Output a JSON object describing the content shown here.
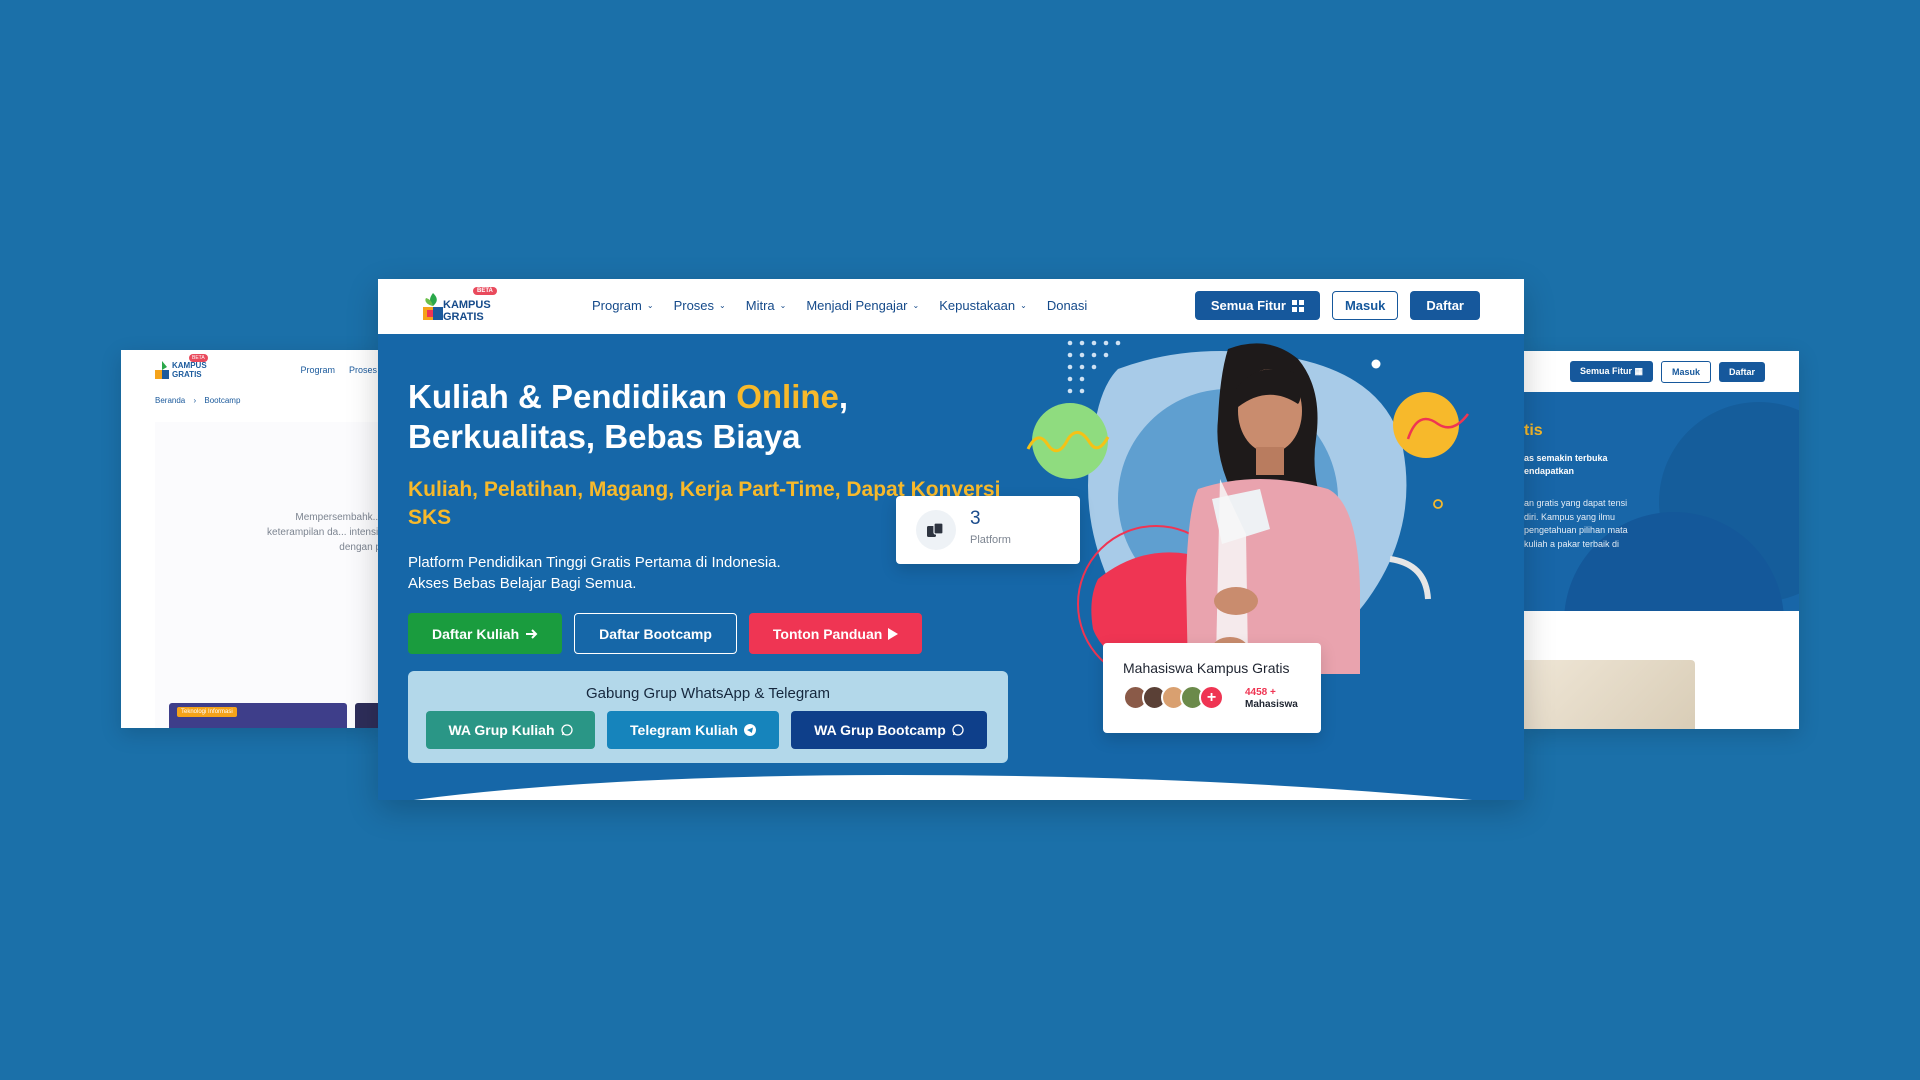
{
  "left_card": {
    "logo": "KAMPUS GRATIS",
    "badge": "BETA",
    "menu": [
      "Program",
      "Proses"
    ],
    "crumb_home": "Beranda",
    "crumb_sep": "›",
    "crumb_current": "Bootcamp",
    "text": "Mempersembahk... keterampilan da... intensif dengan p",
    "chip": "Teknologi Informasi"
  },
  "right_card": {
    "buttons": {
      "fitur": "Semua Fitur",
      "masuk": "Masuk",
      "daftar": "Daftar"
    },
    "title": "tis",
    "subtitle": "as semakin terbuka endapatkan",
    "body": "an gratis yang dapat tensi diri. Kampus yang ilmu pengetahuan pilihan mata kuliah a pakar terbaik di"
  },
  "nav": {
    "logo": "KAMPUS GRATIS",
    "badge": "BETA",
    "menu": [
      {
        "label": "Program"
      },
      {
        "label": "Proses"
      },
      {
        "label": "Mitra"
      },
      {
        "label": "Menjadi Pengajar"
      },
      {
        "label": "Kepustakaan"
      },
      {
        "label": "Donasi"
      }
    ],
    "semua_fitur": "Semua Fitur",
    "masuk": "Masuk",
    "daftar": "Daftar"
  },
  "hero": {
    "title_a": "Kuliah & Pendidikan ",
    "title_highlight": "Online",
    "title_b": ",",
    "title_line2": "Berkualitas, Bebas Biaya",
    "subtitle": "Kuliah, Pelatihan, Magang, Kerja Part-Time, Dapat Konversi SKS",
    "para1": "Platform Pendidikan Tinggi Gratis Pertama di Indonesia.",
    "para2": "Akses Bebas Belajar Bagi Semua.",
    "btn_kuliah": "Daftar Kuliah",
    "btn_bootcamp": "Daftar Bootcamp",
    "btn_panduan": "Tonton Panduan"
  },
  "join": {
    "title": "Gabung Grup WhatsApp & Telegram",
    "wa_kuliah": "WA Grup Kuliah",
    "tg_kuliah": "Telegram Kuliah",
    "wa_bootcamp": "WA Grup Bootcamp"
  },
  "stat": {
    "value": "3",
    "label": "Platform"
  },
  "students": {
    "title": "Mahasiswa Kampus Gratis",
    "count": "4458 +",
    "unit": "Mahasiswa"
  },
  "colors": {
    "background": "#1b70a9",
    "hero": "#1667a8",
    "accent_yellow": "#f7b92b",
    "navy": "#16589c",
    "green": "#1a9c3e",
    "red": "#ef3553"
  }
}
